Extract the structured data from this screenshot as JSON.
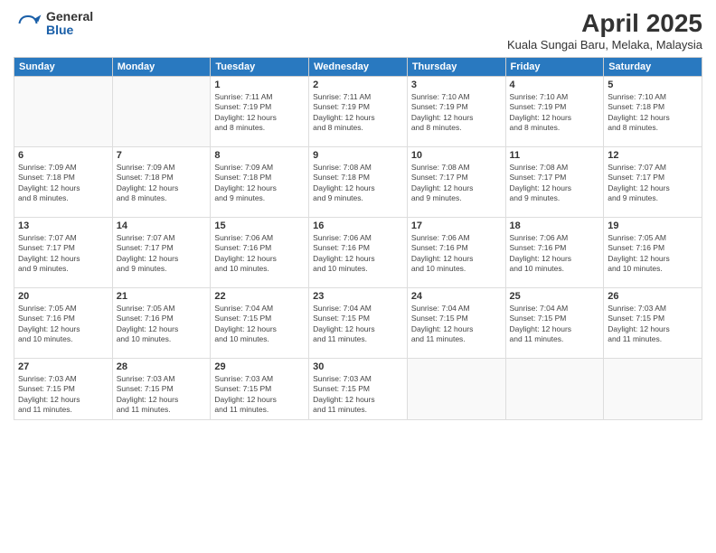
{
  "header": {
    "logo_general": "General",
    "logo_blue": "Blue",
    "title": "April 2025",
    "location": "Kuala Sungai Baru, Melaka, Malaysia"
  },
  "days_of_week": [
    "Sunday",
    "Monday",
    "Tuesday",
    "Wednesday",
    "Thursday",
    "Friday",
    "Saturday"
  ],
  "weeks": [
    [
      {
        "day": null
      },
      {
        "day": null
      },
      {
        "day": 1,
        "sunrise": "7:11 AM",
        "sunset": "7:19 PM",
        "daylight": "12 hours and 8 minutes."
      },
      {
        "day": 2,
        "sunrise": "7:11 AM",
        "sunset": "7:19 PM",
        "daylight": "12 hours and 8 minutes."
      },
      {
        "day": 3,
        "sunrise": "7:10 AM",
        "sunset": "7:19 PM",
        "daylight": "12 hours and 8 minutes."
      },
      {
        "day": 4,
        "sunrise": "7:10 AM",
        "sunset": "7:19 PM",
        "daylight": "12 hours and 8 minutes."
      },
      {
        "day": 5,
        "sunrise": "7:10 AM",
        "sunset": "7:18 PM",
        "daylight": "12 hours and 8 minutes."
      }
    ],
    [
      {
        "day": 6,
        "sunrise": "7:09 AM",
        "sunset": "7:18 PM",
        "daylight": "12 hours and 8 minutes."
      },
      {
        "day": 7,
        "sunrise": "7:09 AM",
        "sunset": "7:18 PM",
        "daylight": "12 hours and 8 minutes."
      },
      {
        "day": 8,
        "sunrise": "7:09 AM",
        "sunset": "7:18 PM",
        "daylight": "12 hours and 9 minutes."
      },
      {
        "day": 9,
        "sunrise": "7:08 AM",
        "sunset": "7:18 PM",
        "daylight": "12 hours and 9 minutes."
      },
      {
        "day": 10,
        "sunrise": "7:08 AM",
        "sunset": "7:17 PM",
        "daylight": "12 hours and 9 minutes."
      },
      {
        "day": 11,
        "sunrise": "7:08 AM",
        "sunset": "7:17 PM",
        "daylight": "12 hours and 9 minutes."
      },
      {
        "day": 12,
        "sunrise": "7:07 AM",
        "sunset": "7:17 PM",
        "daylight": "12 hours and 9 minutes."
      }
    ],
    [
      {
        "day": 13,
        "sunrise": "7:07 AM",
        "sunset": "7:17 PM",
        "daylight": "12 hours and 9 minutes."
      },
      {
        "day": 14,
        "sunrise": "7:07 AM",
        "sunset": "7:17 PM",
        "daylight": "12 hours and 9 minutes."
      },
      {
        "day": 15,
        "sunrise": "7:06 AM",
        "sunset": "7:16 PM",
        "daylight": "12 hours and 10 minutes."
      },
      {
        "day": 16,
        "sunrise": "7:06 AM",
        "sunset": "7:16 PM",
        "daylight": "12 hours and 10 minutes."
      },
      {
        "day": 17,
        "sunrise": "7:06 AM",
        "sunset": "7:16 PM",
        "daylight": "12 hours and 10 minutes."
      },
      {
        "day": 18,
        "sunrise": "7:06 AM",
        "sunset": "7:16 PM",
        "daylight": "12 hours and 10 minutes."
      },
      {
        "day": 19,
        "sunrise": "7:05 AM",
        "sunset": "7:16 PM",
        "daylight": "12 hours and 10 minutes."
      }
    ],
    [
      {
        "day": 20,
        "sunrise": "7:05 AM",
        "sunset": "7:16 PM",
        "daylight": "12 hours and 10 minutes."
      },
      {
        "day": 21,
        "sunrise": "7:05 AM",
        "sunset": "7:16 PM",
        "daylight": "12 hours and 10 minutes."
      },
      {
        "day": 22,
        "sunrise": "7:04 AM",
        "sunset": "7:15 PM",
        "daylight": "12 hours and 10 minutes."
      },
      {
        "day": 23,
        "sunrise": "7:04 AM",
        "sunset": "7:15 PM",
        "daylight": "12 hours and 11 minutes."
      },
      {
        "day": 24,
        "sunrise": "7:04 AM",
        "sunset": "7:15 PM",
        "daylight": "12 hours and 11 minutes."
      },
      {
        "day": 25,
        "sunrise": "7:04 AM",
        "sunset": "7:15 PM",
        "daylight": "12 hours and 11 minutes."
      },
      {
        "day": 26,
        "sunrise": "7:03 AM",
        "sunset": "7:15 PM",
        "daylight": "12 hours and 11 minutes."
      }
    ],
    [
      {
        "day": 27,
        "sunrise": "7:03 AM",
        "sunset": "7:15 PM",
        "daylight": "12 hours and 11 minutes."
      },
      {
        "day": 28,
        "sunrise": "7:03 AM",
        "sunset": "7:15 PM",
        "daylight": "12 hours and 11 minutes."
      },
      {
        "day": 29,
        "sunrise": "7:03 AM",
        "sunset": "7:15 PM",
        "daylight": "12 hours and 11 minutes."
      },
      {
        "day": 30,
        "sunrise": "7:03 AM",
        "sunset": "7:15 PM",
        "daylight": "12 hours and 11 minutes."
      },
      {
        "day": null
      },
      {
        "day": null
      },
      {
        "day": null
      }
    ]
  ],
  "labels": {
    "sunrise_prefix": "Sunrise: ",
    "sunset_prefix": "Sunset: ",
    "daylight_prefix": "Daylight: "
  }
}
